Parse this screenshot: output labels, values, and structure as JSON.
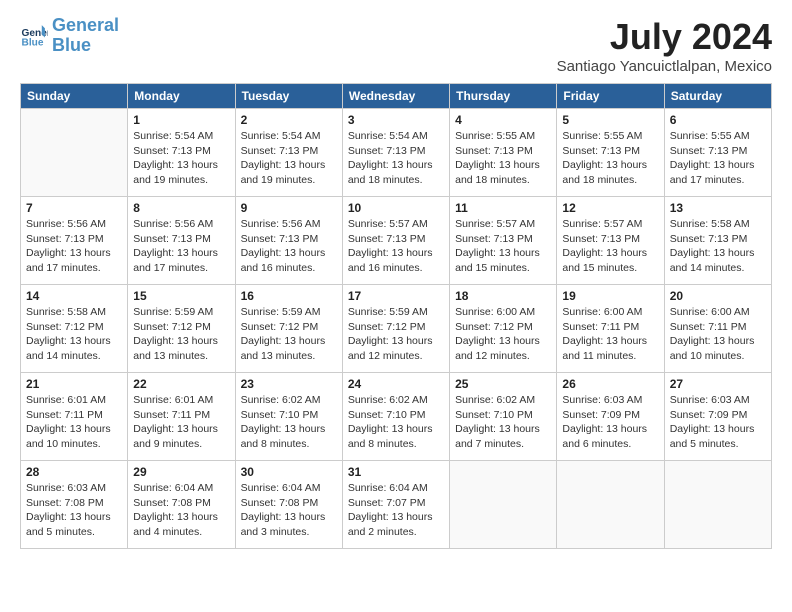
{
  "header": {
    "logo_line1": "General",
    "logo_line2": "Blue",
    "month_year": "July 2024",
    "location": "Santiago Yancuictlalpan, Mexico"
  },
  "weekdays": [
    "Sunday",
    "Monday",
    "Tuesday",
    "Wednesday",
    "Thursday",
    "Friday",
    "Saturday"
  ],
  "weeks": [
    [
      {
        "day": "",
        "info": ""
      },
      {
        "day": "1",
        "info": "Sunrise: 5:54 AM\nSunset: 7:13 PM\nDaylight: 13 hours\nand 19 minutes."
      },
      {
        "day": "2",
        "info": "Sunrise: 5:54 AM\nSunset: 7:13 PM\nDaylight: 13 hours\nand 19 minutes."
      },
      {
        "day": "3",
        "info": "Sunrise: 5:54 AM\nSunset: 7:13 PM\nDaylight: 13 hours\nand 18 minutes."
      },
      {
        "day": "4",
        "info": "Sunrise: 5:55 AM\nSunset: 7:13 PM\nDaylight: 13 hours\nand 18 minutes."
      },
      {
        "day": "5",
        "info": "Sunrise: 5:55 AM\nSunset: 7:13 PM\nDaylight: 13 hours\nand 18 minutes."
      },
      {
        "day": "6",
        "info": "Sunrise: 5:55 AM\nSunset: 7:13 PM\nDaylight: 13 hours\nand 17 minutes."
      }
    ],
    [
      {
        "day": "7",
        "info": "Sunrise: 5:56 AM\nSunset: 7:13 PM\nDaylight: 13 hours\nand 17 minutes."
      },
      {
        "day": "8",
        "info": "Sunrise: 5:56 AM\nSunset: 7:13 PM\nDaylight: 13 hours\nand 17 minutes."
      },
      {
        "day": "9",
        "info": "Sunrise: 5:56 AM\nSunset: 7:13 PM\nDaylight: 13 hours\nand 16 minutes."
      },
      {
        "day": "10",
        "info": "Sunrise: 5:57 AM\nSunset: 7:13 PM\nDaylight: 13 hours\nand 16 minutes."
      },
      {
        "day": "11",
        "info": "Sunrise: 5:57 AM\nSunset: 7:13 PM\nDaylight: 13 hours\nand 15 minutes."
      },
      {
        "day": "12",
        "info": "Sunrise: 5:57 AM\nSunset: 7:13 PM\nDaylight: 13 hours\nand 15 minutes."
      },
      {
        "day": "13",
        "info": "Sunrise: 5:58 AM\nSunset: 7:13 PM\nDaylight: 13 hours\nand 14 minutes."
      }
    ],
    [
      {
        "day": "14",
        "info": "Sunrise: 5:58 AM\nSunset: 7:12 PM\nDaylight: 13 hours\nand 14 minutes."
      },
      {
        "day": "15",
        "info": "Sunrise: 5:59 AM\nSunset: 7:12 PM\nDaylight: 13 hours\nand 13 minutes."
      },
      {
        "day": "16",
        "info": "Sunrise: 5:59 AM\nSunset: 7:12 PM\nDaylight: 13 hours\nand 13 minutes."
      },
      {
        "day": "17",
        "info": "Sunrise: 5:59 AM\nSunset: 7:12 PM\nDaylight: 13 hours\nand 12 minutes."
      },
      {
        "day": "18",
        "info": "Sunrise: 6:00 AM\nSunset: 7:12 PM\nDaylight: 13 hours\nand 12 minutes."
      },
      {
        "day": "19",
        "info": "Sunrise: 6:00 AM\nSunset: 7:11 PM\nDaylight: 13 hours\nand 11 minutes."
      },
      {
        "day": "20",
        "info": "Sunrise: 6:00 AM\nSunset: 7:11 PM\nDaylight: 13 hours\nand 10 minutes."
      }
    ],
    [
      {
        "day": "21",
        "info": "Sunrise: 6:01 AM\nSunset: 7:11 PM\nDaylight: 13 hours\nand 10 minutes."
      },
      {
        "day": "22",
        "info": "Sunrise: 6:01 AM\nSunset: 7:11 PM\nDaylight: 13 hours\nand 9 minutes."
      },
      {
        "day": "23",
        "info": "Sunrise: 6:02 AM\nSunset: 7:10 PM\nDaylight: 13 hours\nand 8 minutes."
      },
      {
        "day": "24",
        "info": "Sunrise: 6:02 AM\nSunset: 7:10 PM\nDaylight: 13 hours\nand 8 minutes."
      },
      {
        "day": "25",
        "info": "Sunrise: 6:02 AM\nSunset: 7:10 PM\nDaylight: 13 hours\nand 7 minutes."
      },
      {
        "day": "26",
        "info": "Sunrise: 6:03 AM\nSunset: 7:09 PM\nDaylight: 13 hours\nand 6 minutes."
      },
      {
        "day": "27",
        "info": "Sunrise: 6:03 AM\nSunset: 7:09 PM\nDaylight: 13 hours\nand 5 minutes."
      }
    ],
    [
      {
        "day": "28",
        "info": "Sunrise: 6:03 AM\nSunset: 7:08 PM\nDaylight: 13 hours\nand 5 minutes."
      },
      {
        "day": "29",
        "info": "Sunrise: 6:04 AM\nSunset: 7:08 PM\nDaylight: 13 hours\nand 4 minutes."
      },
      {
        "day": "30",
        "info": "Sunrise: 6:04 AM\nSunset: 7:08 PM\nDaylight: 13 hours\nand 3 minutes."
      },
      {
        "day": "31",
        "info": "Sunrise: 6:04 AM\nSunset: 7:07 PM\nDaylight: 13 hours\nand 2 minutes."
      },
      {
        "day": "",
        "info": ""
      },
      {
        "day": "",
        "info": ""
      },
      {
        "day": "",
        "info": ""
      }
    ]
  ]
}
